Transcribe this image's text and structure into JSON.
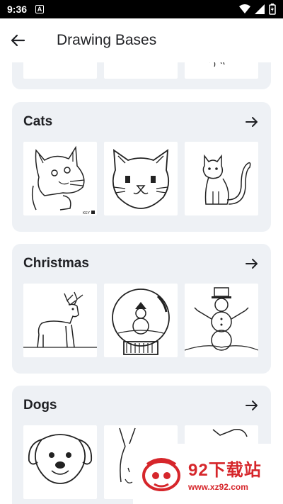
{
  "status_bar": {
    "time": "9:36",
    "notification_icon": "A"
  },
  "app_bar": {
    "title": "Drawing Bases",
    "back_icon": "arrow-left-icon"
  },
  "categories": [
    {
      "name": ""
    },
    {
      "name": "Cats"
    },
    {
      "name": "Christmas"
    },
    {
      "name": "Dogs"
    }
  ],
  "watermark": {
    "title": "92下载站",
    "url": "www.xz92.com"
  },
  "colors": {
    "card_bg": "#eef1f5",
    "watermark_red": "#d6262b"
  }
}
